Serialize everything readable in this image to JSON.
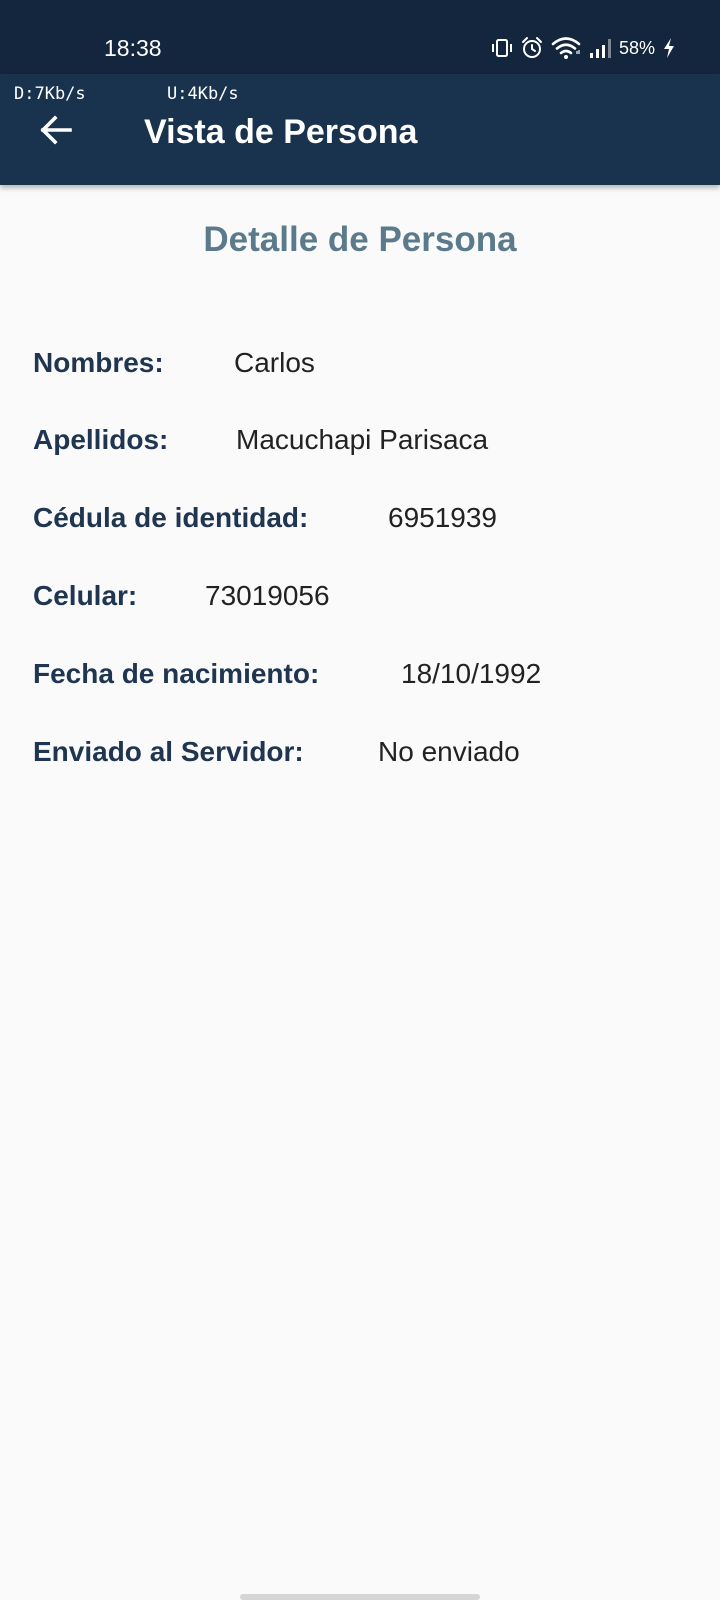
{
  "status_bar": {
    "time": "18:38",
    "battery_percent": "58%",
    "icons": [
      "vibrate-icon",
      "alarm-icon",
      "wifi-icon",
      "signal-icon",
      "charging-icon"
    ]
  },
  "app_bar": {
    "net_down": "D:7Kb/s",
    "net_up": "U:4Kb/s",
    "title": "Vista de Persona",
    "back_icon": "arrow-back-icon"
  },
  "content": {
    "title": "Detalle de Persona",
    "fields": [
      {
        "label": "Nombres:",
        "value": "Carlos"
      },
      {
        "label": "Apellidos:",
        "value": "Macuchapi Parisaca"
      },
      {
        "label": "Cédula de identidad:",
        "value": "6951939"
      },
      {
        "label": "Celular:",
        "value": "73019056"
      },
      {
        "label": "Fecha de nacimiento:",
        "value": "18/10/1992"
      },
      {
        "label": "Enviado al Servidor:",
        "value": "No enviado"
      }
    ]
  },
  "colors": {
    "status_bar": "#13263d",
    "app_bar": "#19334f",
    "title_text": "#5b7a8c",
    "label_text": "#1f3550",
    "background": "#fafafa"
  }
}
